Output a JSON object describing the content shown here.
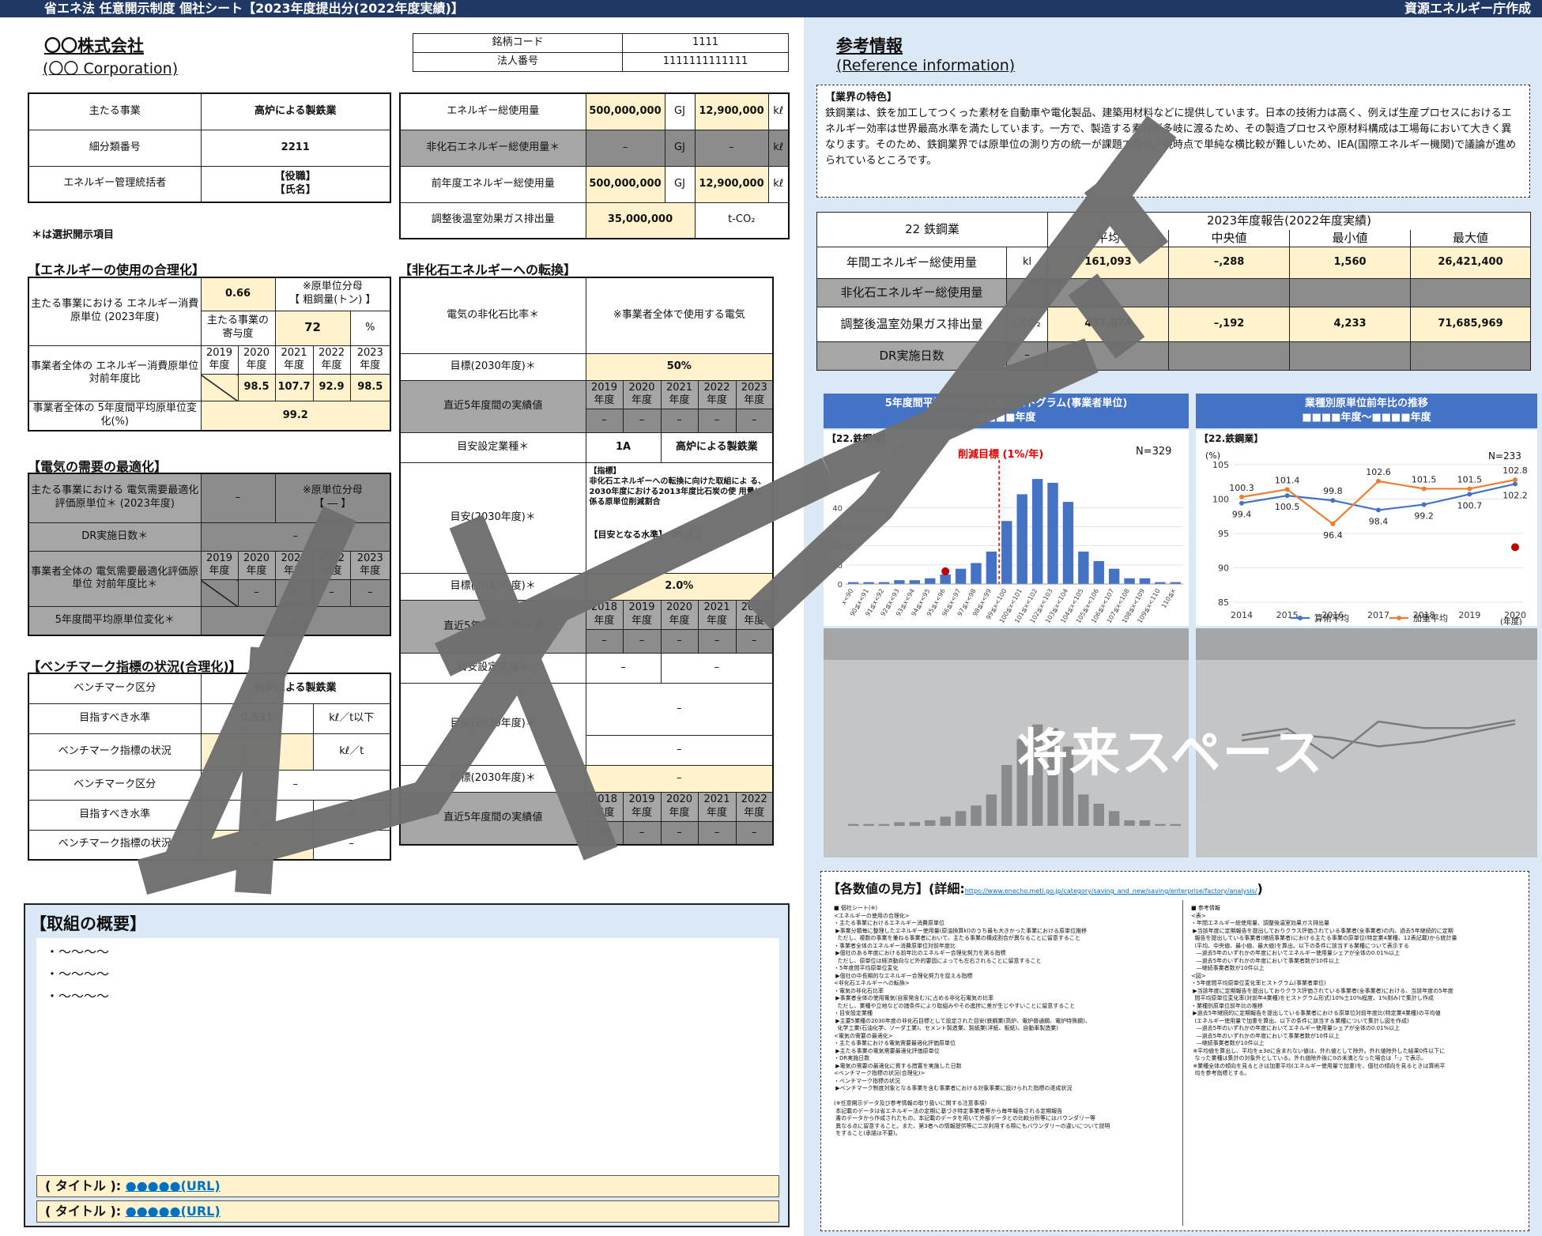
{
  "header": {
    "title": "省エネ法 任意開示制度 個社シート【2023年度提出分(2022年度実績)】",
    "issuer": "資源エネルギー庁作成"
  },
  "company": {
    "name_jp": "〇〇株式会社",
    "name_en": "(〇〇 Corporation)",
    "code_label": "銘柄コード",
    "code_value": "1111",
    "corp_label": "法人番号",
    "corp_value": "1111111111111"
  },
  "business": {
    "main_label": "主たる事業",
    "main_value": "高炉による製鉄業",
    "class_label": "細分類番号",
    "class_value": "2211",
    "manager_label": "エネルギー管理統括者",
    "manager_value1": "【役職】",
    "manager_value2": "【氏名】"
  },
  "energy_totals": {
    "total_label": "エネルギー総使用量",
    "total_gj": "500,000,000",
    "total_kl": "12,900,000",
    "nonfossil_label": "非化石エネルギー総使用量＊",
    "nonfossil_gj": "–",
    "nonfossil_kl": "–",
    "prev_label": "前年度エネルギー総使用量",
    "prev_gj": "500,000,000",
    "prev_kl": "12,900,000",
    "ghg_label": "調整後温室効果ガス排出量",
    "ghg_value": "35,000,000",
    "unit_gj": "GJ",
    "unit_kl": "kℓ",
    "unit_co2": "t-CO₂"
  },
  "optional_note": "＊は選択開示項目",
  "rationalization": {
    "title": "【エネルギーの使用の合理化】",
    "intensity_label": "主たる事業における エネルギー消費原単位 (2023年度)",
    "intensity_value": "0.66",
    "denominator_note1": "※原単位分母",
    "denominator_note2": "【 粗鋼量(トン) 】",
    "share_label": "主たる事業の寄与度",
    "share_value": "72",
    "share_unit": "%",
    "yoy_label": "事業者全体の エネルギー消費原単位 対前年度比",
    "years": [
      "2019年度",
      "2020年度",
      "2021年度",
      "2022年度",
      "2023年度"
    ],
    "yoy_values": [
      "",
      "98.5",
      "107.7",
      "92.9",
      "98.5"
    ],
    "avg_label": "事業者全体の 5年度間平均原単位変化(%)",
    "avg_value": "99.2"
  },
  "electricity": {
    "title": "【電気の需要の最適化】",
    "intensity_label": "主たる事業における 電気需要最適化評価原単位＊ (2023年度)",
    "intensity_value": "–",
    "denominator_note1": "※原単位分母",
    "denominator_note2": "【 ― 】",
    "dr_label": "DR実施日数＊",
    "dr_value": "–",
    "yoy_label": "事業者全体の 電気需要最適化評価原単位 対前年度比＊",
    "years": [
      "2019年度",
      "2020年度",
      "2021年度",
      "2022年度",
      "2023年度"
    ],
    "yoy_values": [
      "",
      "–",
      "–",
      "–",
      "–"
    ],
    "avg_label": "5年度間平均原単位変化＊",
    "avg_value": "–"
  },
  "benchmark": {
    "title": "【ベンチマーク指標の状況(合理化)】",
    "rows": [
      {
        "label": "ベンチマーク区分",
        "value": "高炉による製鉄業",
        "unit": ""
      },
      {
        "label": "目指すべき水準",
        "value": "0.531",
        "unit": "kℓ／t以下"
      },
      {
        "label": "ベンチマーク指標の状況",
        "value": "",
        "unit": "kℓ／t"
      },
      {
        "label": "ベンチマーク区分",
        "value": "–",
        "unit": ""
      },
      {
        "label": "目指すべき水準",
        "value": "–",
        "unit": "–"
      },
      {
        "label": "ベンチマーク指標の状況",
        "value": "–",
        "unit": "–"
      }
    ]
  },
  "nonfossil": {
    "title": "【非化石エネルギーへの転換】",
    "ratio_label": "電気の非化石比率＊",
    "ratio_note": "※事業者全体で使用する電気",
    "target_label": "目標(2030年度)＊",
    "target_value": "50%",
    "recent_label": "直近5年度間の実績値",
    "years_a": [
      "2019年度",
      "2020年度",
      "2021年度",
      "2022年度",
      "2023年度"
    ],
    "recent_values_a": [
      "–",
      "–",
      "–",
      "–",
      "–"
    ],
    "industry_label": "目安設定業種＊",
    "industry_code": "1A",
    "industry_name": "高炉による製鉄業",
    "guide_label": "目安(2030年度)＊",
    "guide_head": "【指標】",
    "guide_text": "非化石エネルギーへの転換に向けた取組によ る、2030年度における2013年度比石炭の使 用量に係る原単位削減割合",
    "guide_level": "【目安となる水準】 2%以上",
    "target2_label": "目標(2030年度)＊",
    "target2_value": "2.0%",
    "recent2_label": "直近5年度間の実績値",
    "years_b": [
      "2018年度",
      "2019年度",
      "2020年度",
      "2021年度",
      "2022年度"
    ],
    "recent_values_b": [
      "–",
      "–",
      "–",
      "–",
      "–"
    ],
    "industry2_label": "目安設定業種＊",
    "industry2_code": "–",
    "industry2_name": "–",
    "guide2_label": "目安(2030年度)＊",
    "guide2_value": "–",
    "guide2_sub": "–",
    "target3_label": "目標(2030年度)＊",
    "target3_value": "–",
    "recent3_label": "直近5年度間の実績値",
    "years_c": [
      "2018年度",
      "2019年度",
      "2020年度",
      "2021年度",
      "2022年度"
    ],
    "recent_values_c": [
      "–",
      "–",
      "–",
      "–",
      "–"
    ]
  },
  "summary": {
    "title": "【取組の概要】",
    "bullets": [
      "・～～～～",
      "・～～～～",
      "・～～～～"
    ],
    "links": [
      {
        "label": "( タイトル ):",
        "url": "●●●●●(URL)"
      },
      {
        "label": "( タイトル ):",
        "url": "●●●●●(URL)"
      }
    ]
  },
  "reference": {
    "title": "参考情報",
    "title_en": "(Reference information)",
    "feature_title": "【業界の特色】",
    "feature_text": "鉄鋼業は、鉄を加工してつくった素材を自動車や電化製品、建築用材料などに提供しています。日本の技術力は高く、例えば生産プロセスにおけるエネルギー効率は世界最高水準を満たしています。一方で、製造する素材が多岐に渡るため、その製造プロセスや原材料構成は工場毎において大きく異なります。そのため、鉄鋼業界では原単位の測り方の統一が課題であり、現時点で単純な横比較が難しいため、IEA(国際エネルギー機関)で議論が進められているところです。",
    "stats": {
      "industry": "22 鉄鋼業",
      "period": "2023年度報告(2022年度実績)",
      "cols": [
        "平均",
        "中央値",
        "最小値",
        "最大値"
      ],
      "rows": [
        {
          "label": "年間エネルギー総使用量",
          "unit": "kl",
          "values": [
            "161,093",
            "–,288",
            "1,560",
            "26,421,400"
          ],
          "gray": false
        },
        {
          "label": "非化石エネルギー総使用量",
          "unit": "",
          "values": [
            "",
            "",
            "",
            ""
          ],
          "gray": true
        },
        {
          "label": "調整後温室効果ガス排出量",
          "unit": "t-CO₂",
          "values": [
            "437,074",
            "–,192",
            "4,233",
            "71,685,969"
          ],
          "gray": false
        },
        {
          "label": "DR実施日数",
          "unit": "–",
          "values": [
            "",
            "",
            "",
            ""
          ],
          "gray": true
        }
      ]
    }
  },
  "charts_text": {
    "hist_header1": "5年度間平均原単位変化率ヒストグラム(事業者単位)",
    "hist_header2": "■■■■年度",
    "hist_section": "【22.鉄鋼業】",
    "hist_target": "削減目標 (1%/年)",
    "hist_n": "N=329",
    "line_header1": "業種別原単位前年比の推移",
    "line_header2": "■■■■年度～■■■■年度",
    "line_section": "【22.鉄鋼業】",
    "line_unit": "(%)",
    "line_n": "N=233",
    "line_xunit": "(年度)",
    "future_space": "将来スペース"
  },
  "chart_data": [
    {
      "type": "bar",
      "title": "5年度間平均原単位変化率ヒストグラム(事業者単位)",
      "categories": [
        "x<90",
        "90≦x<91",
        "91≦x<92",
        "92≦x<93",
        "93≦x<94",
        "94≦x<95",
        "95≦x<96",
        "96≦x<97",
        "97≦x<98",
        "98≦x<99",
        "99≦x<100",
        "100≦x<101",
        "101≦x<102",
        "102≦x<103",
        "103≦x<104",
        "104≦x<105",
        "105≦x<106",
        "106≦x<107",
        "107≦x<108",
        "108≦x<109",
        "109≦x<110",
        "110≦x"
      ],
      "values": [
        1,
        1,
        1,
        2,
        2,
        3,
        5,
        8,
        11,
        17,
        33,
        47,
        55,
        53,
        43,
        17,
        12,
        8,
        3,
        3,
        1,
        1
      ],
      "ylim": [
        0,
        60
      ],
      "yticks": [
        0,
        10,
        20,
        30,
        40
      ],
      "target_line_after_index": 9,
      "marker_index": 6,
      "n_label": "N=329"
    },
    {
      "type": "line",
      "title": "業種別原単位前年比の推移",
      "x": [
        2014,
        2015,
        2016,
        2017,
        2018,
        2019,
        2020
      ],
      "series": [
        {
          "name": "算術平均",
          "values": [
            99.4,
            100.5,
            99.8,
            98.4,
            99.2,
            100.7,
            102.2
          ],
          "color": "#4472c4"
        },
        {
          "name": "加重平均",
          "values": [
            100.3,
            101.4,
            96.4,
            102.6,
            101.5,
            101.5,
            102.8
          ],
          "color": "#ed7d31"
        }
      ],
      "point_labels_top": [
        "100.3",
        "101.4",
        "99.8",
        "102.6",
        "101.5",
        "101.5",
        "102.8"
      ],
      "point_labels_bottom": [
        "99.4",
        "100.5",
        "96.4",
        "98.4",
        "99.2",
        "100.7",
        "102.2"
      ],
      "ylim": [
        85,
        105
      ],
      "yticks": [
        85,
        90,
        95,
        100,
        105
      ],
      "marker": {
        "x": 2020,
        "y": 93
      },
      "n_label": "N=233"
    }
  ],
  "howto": {
    "title": "【各数値の見方】(詳細:",
    "link": "https://www.enecho.meti.go.jp/category/saving_and_new/saving/enterprise/factory/analysis/",
    "title_close": ")",
    "left_text": "■ 個社シート(※)\n<エネルギーの使用の合理化>\n・主たる事業におけるエネルギー消費原単位\n ▶事業分類毎に整理したエネルギー使用量(原油換算kl)のうち最も大きかった事業における原単位推移\n  ただし、複数の事業を兼ねる事業者において、主たる事業の構成割合が異なることに留意すること\n・事業者全体のエネルギー消費原単位対前年度比\n ▶個社のある年度における前年比のエネルギー合理化努力を測る指標\n  ただし、原単位は経済動向など外的要因によっても左右されることに留意すること\n・5年度間平均原単位変化\n ▶個社の中長期的なエネルギー合理化努力を捉える指標\n<非化石エネルギーへの転換>\n・電気の非化石比率\n ▶事業者全体の使用電気(自家発含む)に占める非化石電気の比率\n  ただし、業種や立地などの諸条件により取組みやその進捗に差が生じやすいことに留意すること\n・目安設定業種\n ▶主要5業種の2030年度の非化石目標として設定された目安(鉄鋼業(高炉、電炉普通鋼、電炉特殊鋼)、\n  化学工業(石油化学、ソーダ工業)、セメント製造業、製紙業(洋紙、板紙)、自動車製造業)\n<電気の需要の最適化>\n・主たる事業における電気需要最適化評価原単位\n ▶主たる事業の電気需要最適化評価原単位\n・DR実施日数\n ▶電気の需要の最適化に資する措置を実施した日数\n<ベンチマーク指標の状況(合理化)>\n・ベンチマーク指標の状況\n ▶ベンチマーク制度対象となる事業を含む事業者における対象事業に設けられた指標の達成状況\n\n(※任意開示データ及び参考情報の取り扱いに関する注意事項)\n 本記載のデータは省エネルギー法の定期に基づき特定事業者等から毎年報告される定期報告\n 書のデータから作成されたもの。本記載のデータを用いて外部データとの比較分析等にはバウンダリー等\n 異なる点に留意すること。また、第3者への情報提供等に二次利用する際にもバウンダリーの違いについて説明\n をすること(承諾は不要)。",
    "right_text": "■ 参考情報\n<表>\n・年間エネルギー総使用量、調整後温室効果ガス排出量\n ▶当該年度に定期報告を提出しておりクラス評価されている事業者(全事業者)の内、過去5年継続的に定期\n  報告を提出している事業者(継続事業者)における主たる事業の原単位(特定業4業種、12表記載)から統計量\n  (平均、中央値、最小値、最大値)を算出。以下の条件に該当する業種について表示する\n   ―過去5年のいずれかの年度においてエネルギー使用量シェアが全体の0.01%以上\n   ―過去5年のいずれかの年度において事業者数が10件以上\n   ―継続事業者数が10件以上\n<図>\n・5年度間平均原単位変化率ヒストグラム(事業者単位)\n ▶当該年度に定期報告を提出しておりクラス評価されている事業者(全事業者)における、当該年度の5年度\n  間平均原単位変化率(対前年4業種)をヒストグラム形式(10%土10%程度、1%刻み)で集計し作成\n・業種別原単位前年比の推移\n ▶過去5年継続的に定期報告を提出している事業者における原単位対前年度比(特定業4業種)の平均値\n  (エネルギー使用量で加重を算出、以下の条件に該当する業種について集計し図を作成)\n   ―過去5年のいずれかの年度においてエネルギー使用量シェアが全体の0.01%以上\n   ―過去5年のいずれかの年度において事業者数が10件以上\n   ―継続事業者数が10件以上\n ※平均値を算出し、平均を±3σに含まれない値は、外れ値として除外。外れ値除外した結果0件以下に\n  なった業種は集計の対象外としている。外れ値除外後に0の未満となった場合は「-」で表示。\n ※業種全体の傾向を見るときは加重平均(エネルギー使用量で加重)を、個社の傾向を見るときは算術平\n  均を参考指標とする。"
  }
}
